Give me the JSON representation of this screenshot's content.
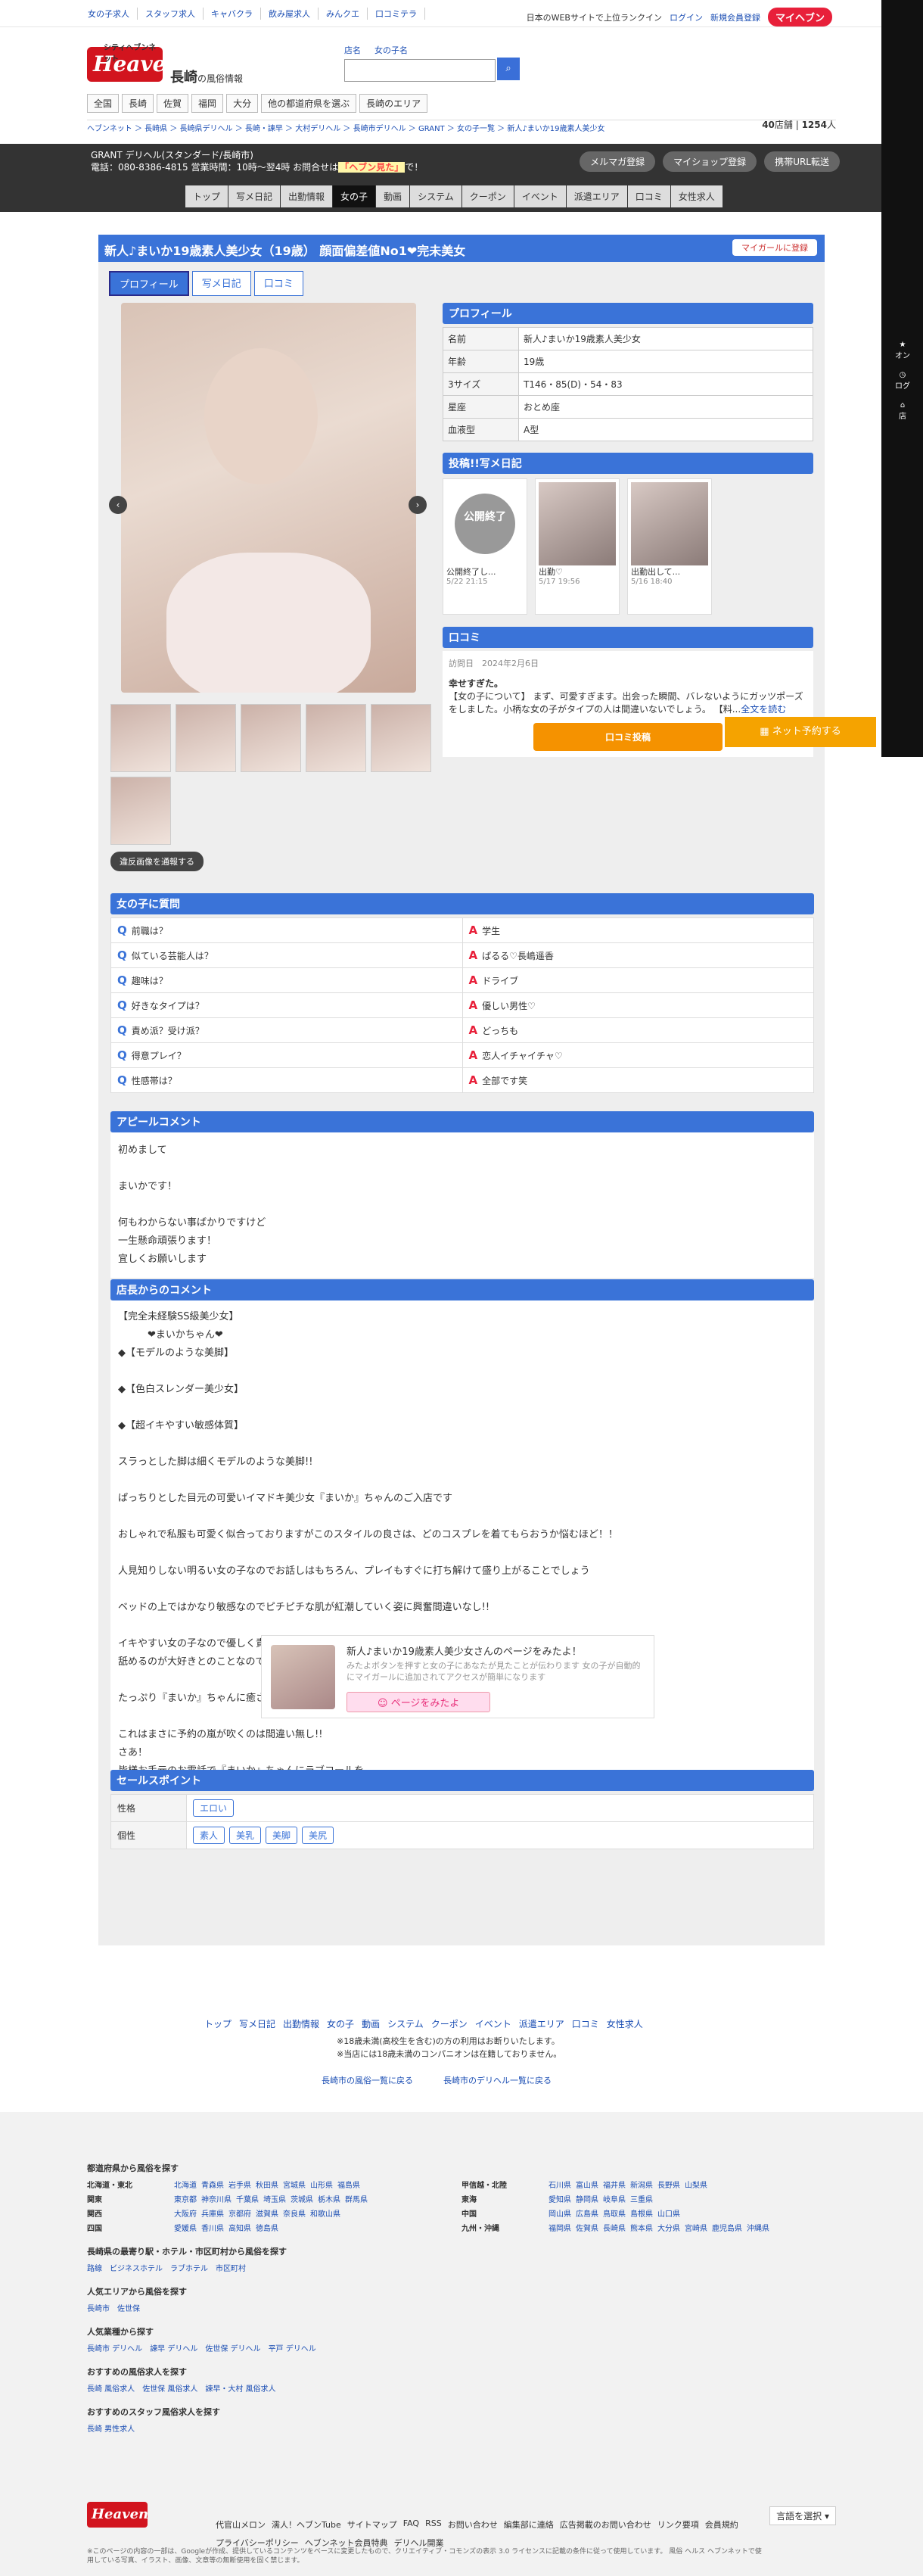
{
  "topbar": {
    "links": [
      "女の子求人",
      "スタッフ求人",
      "キャバクラ",
      "飲み屋求人",
      "みんクエ",
      "口コミテラ"
    ],
    "right": [
      "日本のWEBサイトで上位ランクイン",
      "ログイン",
      "新規会員登録"
    ],
    "myheaven": "マイヘブン"
  },
  "sidebar_right": [
    "オン",
    "ログ",
    "店"
  ],
  "header": {
    "logo": "Heaven",
    "logo_sub": "シティヘブンネット",
    "area": "長崎",
    "area_sub": "の風俗情報",
    "search_tabs": [
      "店名",
      "女の子名"
    ],
    "nav": [
      "全国",
      "長崎",
      "佐賀",
      "福岡",
      "大分",
      "他の都道府県を選ぶ",
      "長崎のエリア"
    ],
    "shop_count": "40",
    "shop_unit": "店舗",
    "girl_count": "1254",
    "girl_unit": "人"
  },
  "breadcrumb": "ヘブンネット ＞ 長崎県 ＞ 長崎県デリヘル ＞ 長崎・諫早 ＞ 大村デリヘル ＞ 長崎市デリヘル ＞ GRANT ＞ 女の子一覧 ＞ 新人♪まいか19歳素人美少女",
  "shop": {
    "name": "GRANT デリヘル(スタンダード/長崎市)",
    "tel": "電話：080-8386-4815 営業時間：10時〜翌4時 お問合せは",
    "tel_em": "「ヘブン見た」",
    "tel_tail": "で！",
    "btns": [
      "メルマガ登録",
      "マイショップ登録",
      "携帯URL転送"
    ],
    "nav": [
      "トップ",
      "写メ日記",
      "出勤情報",
      "女の子",
      "動画",
      "システム",
      "クーポン",
      "イベント",
      "派遣エリア",
      "口コミ",
      "女性求人"
    ]
  },
  "girl": {
    "title": "新人♪まいか19歳素人美少女（19歳） 顔面偏差値No1❤完未美女",
    "mylist": "マイガールに登録",
    "tabs": [
      "プロフィール",
      "写メ日記",
      "口コミ"
    ],
    "report": "違反画像を通報する"
  },
  "profile": {
    "head": "プロフィール",
    "rows": [
      {
        "k": "名前",
        "v": "新人♪まいか19歳素人美少女"
      },
      {
        "k": "年齢",
        "v": "19歳"
      },
      {
        "k": "3サイズ",
        "v": "T146・85(D)・54・83"
      },
      {
        "k": "星座",
        "v": "おとめ座"
      },
      {
        "k": "血液型",
        "v": "A型"
      }
    ]
  },
  "diary": {
    "head": "投稿!!写メ日記",
    "items": [
      {
        "closed": "公開終了",
        "title": "公開終了し...",
        "date": "5/22 21:15"
      },
      {
        "title": "出勤♡",
        "date": "5/17 19:56"
      },
      {
        "title": "出勤出して...",
        "date": "5/16 18:40"
      }
    ]
  },
  "review": {
    "head": "口コミ",
    "visit_label": "訪問日",
    "visit": "2024年2月6日",
    "title": "幸せすぎた。",
    "body": "【女の子について】 まず、可愛すぎます。出会った瞬間、バレないようにガッツポーズをしました。小柄な女の子がタイプの人は間違いないでしょう。 【料...",
    "more": "全文を読む",
    "btn": "口コミ投稿"
  },
  "hot": "ネット予約する",
  "qa": {
    "head": "女の子に質問",
    "items": [
      {
        "q": "前職は？",
        "a": "学生"
      },
      {
        "q": "似ている芸能人は？",
        "a": "ぱるる♡長嶋遥香"
      },
      {
        "q": "趣味は？",
        "a": "ドライブ"
      },
      {
        "q": "好きなタイプは？",
        "a": "優しい男性♡"
      },
      {
        "q": "責め派？受け派？",
        "a": "どっちも"
      },
      {
        "q": "得意プレイ？",
        "a": "恋人イチャイチャ♡"
      },
      {
        "q": "性感帯は？",
        "a": "全部です笑"
      }
    ]
  },
  "appeal": {
    "head": "アピールコメント",
    "lines": [
      "初めまして",
      "",
      "まいかです！",
      "",
      "何もわからない事ばかりですけど",
      "一生懸命頑張ります！",
      "宜しくお願いします"
    ]
  },
  "comment": {
    "head": "店長からのコメント",
    "lines": [
      "【完全未経験SS級美少女】",
      "　　　❤まいかちゃん❤",
      "◆【モデルのような美脚】",
      "",
      "◆【色白スレンダー美少女】",
      "",
      "◆【超イキやすい敏感体質】",
      "",
      "スラっとした脚は細くモデルのような美脚!!",
      "",
      "ぱっちりとした目元の可愛いイマドキ美少女『まいか』ちゃんのご入店です",
      "",
      "おしゃれで私服も可愛く似合っておりますがこのスタイルの良さは、どのコスプレを着てもらおうか悩むほど！！",
      "",
      "人見知りしない明るい女の子なのでお話しはもちろん、プレイもすぐに打ち解けて盛り上がることでしょう",
      "",
      "ベッドの上ではかなり敏感なのでピチピチな肌が紅潮していく姿に興奮間違いなし!!",
      "",
      "イキやすい女の子なので優しく責めてあげてください",
      "舐めるのが大好きとのことなので攻守交替してもご堪能いただけます",
      "",
      "たっぷり『まいか』ちゃんに癒されてください",
      "",
      "これはまさに予約の嵐が吹くのは間違い無し!!",
      "さあ！",
      "皆様お手元のお電話で『まいか』ちゃんにラブコールを"
    ]
  },
  "sales": {
    "head": "セールスポイント",
    "rows": [
      {
        "k": "性格",
        "tags": [
          "エロい"
        ]
      },
      {
        "k": "個性",
        "tags": [
          "素人",
          "美乳",
          "美脚",
          "美尻"
        ]
      }
    ]
  },
  "promo": {
    "title": "新人♪まいか19歳素人美少女さんのページをみたよ！",
    "sub": "みたよボタンを押すと女の子にあなたが見たことが伝わります 女の子が自動的にマイガールに追加されてアクセスが簡単になります",
    "btn": "ページをみたよ"
  },
  "footnav": [
    "トップ",
    "写メ日記",
    "出勤情報",
    "女の子",
    "動画",
    "システム",
    "クーポン",
    "イベント",
    "派遣エリア",
    "口コミ",
    "女性求人"
  ],
  "footnote": [
    "※18歳未満(高校生を含む)の方の利用はお断りいたします。",
    "※当店には18歳未満のコンパニオンは在籍しておりません。"
  ],
  "footlinks": [
    "長崎市の風俗一覧に戻る",
    "長崎市のデリヘル一覧に戻る"
  ],
  "footer": {
    "h1": "都道府県から風俗を探す",
    "regions": [
      {
        "r": "北海道・東北",
        "p": [
          "北海道",
          "青森県",
          "岩手県",
          "秋田県",
          "宮城県",
          "山形県",
          "福島県"
        ],
        "r2": "甲信越・北陸",
        "p2": [
          "石川県",
          "富山県",
          "福井県",
          "新潟県",
          "長野県",
          "山梨県"
        ]
      },
      {
        "r": "関東",
        "p": [
          "東京都",
          "神奈川県",
          "千葉県",
          "埼玉県",
          "茨城県",
          "栃木県",
          "群馬県"
        ],
        "r2": "東海",
        "p2": [
          "愛知県",
          "静岡県",
          "岐阜県",
          "三重県"
        ]
      },
      {
        "r": "関西",
        "p": [
          "大阪府",
          "兵庫県",
          "京都府",
          "滋賀県",
          "奈良県",
          "和歌山県"
        ],
        "r2": "中国",
        "p2": [
          "岡山県",
          "広島県",
          "鳥取県",
          "島根県",
          "山口県"
        ]
      },
      {
        "r": "四国",
        "p": [
          "愛媛県",
          "香川県",
          "高知県",
          "徳島県"
        ],
        "r2": "九州・沖縄",
        "p2": [
          "福岡県",
          "佐賀県",
          "長崎県",
          "熊本県",
          "大分県",
          "宮崎県",
          "鹿児島県",
          "沖縄県"
        ]
      }
    ],
    "h2": "長崎県の最寄り駅・ホテル・市区町村から風俗を探す",
    "l2": [
      "路線",
      "ビジネスホテル",
      "ラブホテル",
      "市区町村"
    ],
    "h3": "人気エリアから風俗を探す",
    "l3": [
      "長崎市",
      "佐世保"
    ],
    "h4": "人気業種から探す",
    "l4": [
      "長崎市 デリヘル",
      "諫早 デリヘル",
      "佐世保 デリヘル",
      "平戸 デリヘル"
    ],
    "h5": "おすすめの風俗求人を探す",
    "l5": [
      "長崎 風俗求人",
      "佐世保 風俗求人",
      "諫早・大村 風俗求人"
    ],
    "h6": "おすすめのスタッフ風俗求人を探す",
    "l6": [
      "長崎 男性求人"
    ],
    "logo": "Heaven",
    "bottom": [
      "代官山メロン",
      "濡人！ヘブンTube",
      "サイトマップ",
      "FAQ",
      "RSS",
      "お問い合わせ",
      "編集部に連絡",
      "広告掲載のお問い合わせ",
      "リンク要項",
      "会員規約",
      "プライバシーポリシー",
      "ヘブンネット会員特典",
      "デリヘル開業"
    ],
    "lang": "言語を選択",
    "copy": "※このページの内容の一部は、Googleが作成、提供しているコンテンツをベースに変更したもので、クリエイティブ・コモンズの表示 3.0 ライセンスに記載の条件に従って使用しています。 風俗 ヘルス ヘブンネットで使用している写真、イラスト、画像、文章等の無断使用を固く禁じます。"
  }
}
